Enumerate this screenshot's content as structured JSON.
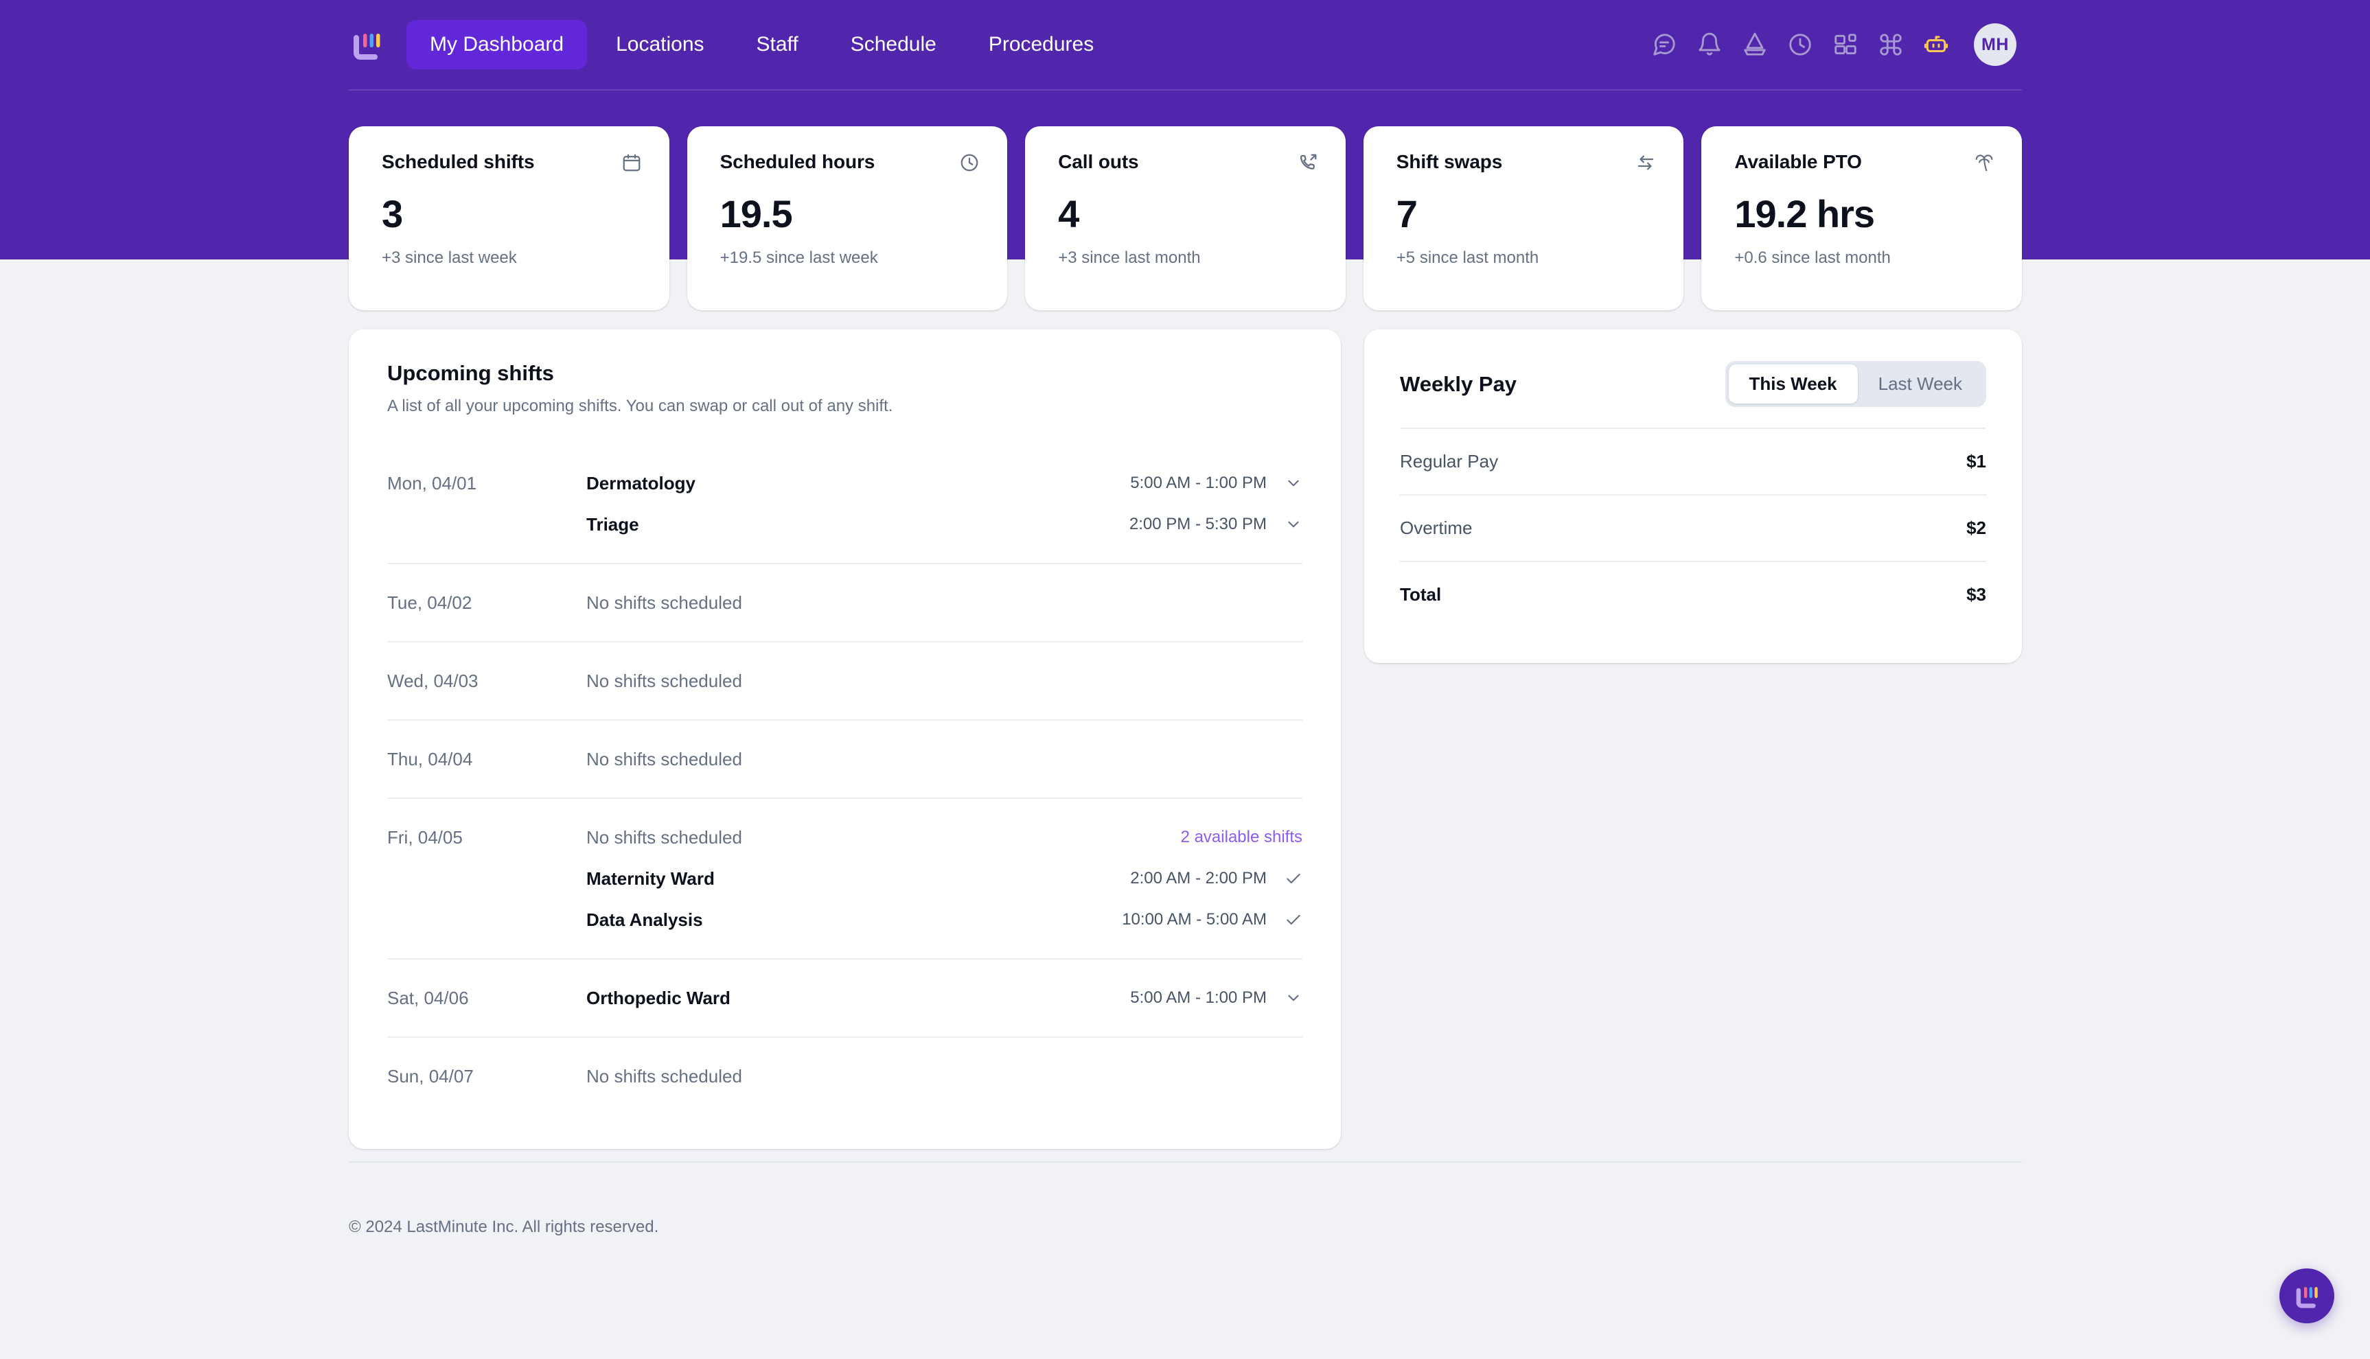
{
  "brand": {
    "name": "LastMinute",
    "logo_icon": "lastminute-logo-icon",
    "colors": {
      "header_purple": "#5225AD",
      "active_pill": "#6227D8",
      "link_purple": "#8B5CF6",
      "page_bg": "#F1F2F5",
      "robot_yellow": "#FBC94F"
    }
  },
  "nav": {
    "items": [
      {
        "label": "My Dashboard",
        "active": true
      },
      {
        "label": "Locations",
        "active": false
      },
      {
        "label": "Staff",
        "active": false
      },
      {
        "label": "Schedule",
        "active": false
      },
      {
        "label": "Procedures",
        "active": false
      }
    ],
    "icons": [
      "message-icon",
      "bell-icon",
      "sailboat-icon",
      "clock-icon",
      "layout-grid-icon",
      "command-icon",
      "robot-icon"
    ],
    "avatar_initials": "MH"
  },
  "stats": [
    {
      "title": "Scheduled shifts",
      "value": "3",
      "delta": "+3 since last week",
      "icon": "calendar-icon"
    },
    {
      "title": "Scheduled hours",
      "value": "19.5",
      "delta": "+19.5 since last week",
      "icon": "clock-icon"
    },
    {
      "title": "Call outs",
      "value": "4",
      "delta": "+3 since last month",
      "icon": "phone-outgoing-icon"
    },
    {
      "title": "Shift swaps",
      "value": "7",
      "delta": "+5 since last month",
      "icon": "arrows-swap-icon"
    },
    {
      "title": "Available PTO",
      "value": "19.2 hrs",
      "delta": "+0.6 since last month",
      "icon": "palm-tree-icon"
    }
  ],
  "shifts": {
    "title": "Upcoming shifts",
    "subtitle": "A list of all your upcoming shifts. You can swap or call out of any shift.",
    "no_shifts_label": "No shifts scheduled",
    "days": [
      {
        "day": "Mon, 04/01",
        "rows": [
          {
            "name": "Dermatology",
            "time": "5:00 AM - 1:00 PM",
            "action": "chevron-down-icon"
          },
          {
            "name": "Triage",
            "time": "2:00 PM - 5:30 PM",
            "action": "chevron-down-icon"
          }
        ]
      },
      {
        "day": "Tue, 04/02",
        "rows": [
          {
            "name": "No shifts scheduled",
            "empty": true
          }
        ]
      },
      {
        "day": "Wed, 04/03",
        "rows": [
          {
            "name": "No shifts scheduled",
            "empty": true
          }
        ]
      },
      {
        "day": "Thu, 04/04",
        "rows": [
          {
            "name": "No shifts scheduled",
            "empty": true
          }
        ]
      },
      {
        "day": "Fri, 04/05",
        "rows": [
          {
            "name": "No shifts scheduled",
            "empty": true,
            "link": "2 available shifts"
          },
          {
            "name": "Maternity Ward",
            "time": "2:00 AM - 2:00 PM",
            "action": "check-icon"
          },
          {
            "name": "Data Analysis",
            "time": "10:00 AM - 5:00 AM",
            "action": "check-icon"
          }
        ]
      },
      {
        "day": "Sat, 04/06",
        "rows": [
          {
            "name": "Orthopedic Ward",
            "time": "5:00 AM - 1:00 PM",
            "action": "chevron-down-icon"
          }
        ]
      },
      {
        "day": "Sun, 04/07",
        "rows": [
          {
            "name": "No shifts scheduled",
            "empty": true
          }
        ]
      }
    ]
  },
  "pay": {
    "title": "Weekly Pay",
    "toggle": [
      {
        "label": "This Week",
        "active": true
      },
      {
        "label": "Last Week",
        "active": false
      }
    ],
    "rows": [
      {
        "label": "Regular Pay",
        "amount": "$1",
        "total": false
      },
      {
        "label": "Overtime",
        "amount": "$2",
        "total": false
      },
      {
        "label": "Total",
        "amount": "$3",
        "total": true
      }
    ]
  },
  "footer": {
    "text": "© 2024 LastMinute Inc. All rights reserved."
  },
  "fab": {
    "icon": "lastminute-logo-icon"
  }
}
